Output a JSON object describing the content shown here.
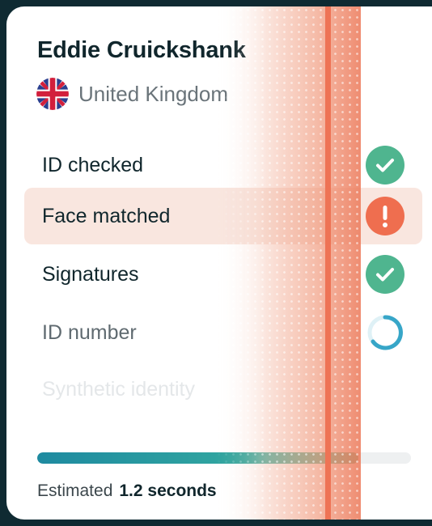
{
  "person": {
    "name": "Eddie Cruickshank",
    "country": "United Kingdom",
    "flag_icon": "uk-flag-icon"
  },
  "checks": [
    {
      "label": "ID checked",
      "status": "success",
      "icon": "check-circle-icon"
    },
    {
      "label": "Face matched",
      "status": "warning",
      "icon": "exclamation-circle-icon"
    },
    {
      "label": "Signatures",
      "status": "success",
      "icon": "check-circle-icon"
    },
    {
      "label": "ID number",
      "status": "loading",
      "icon": "spinner-icon"
    },
    {
      "label": "Synthetic identity",
      "status": "pending",
      "icon": ""
    }
  ],
  "progress": {
    "fraction": 0.86,
    "estimate_label": "Estimated",
    "estimate_value": "1.2 seconds"
  },
  "colors": {
    "success": "#4fb58f",
    "warning": "#ef6e4f",
    "highlight": "#f9e6df",
    "loading": "#37a6c8",
    "scan_line": "#ee7355",
    "text_dark": "#10262c"
  }
}
